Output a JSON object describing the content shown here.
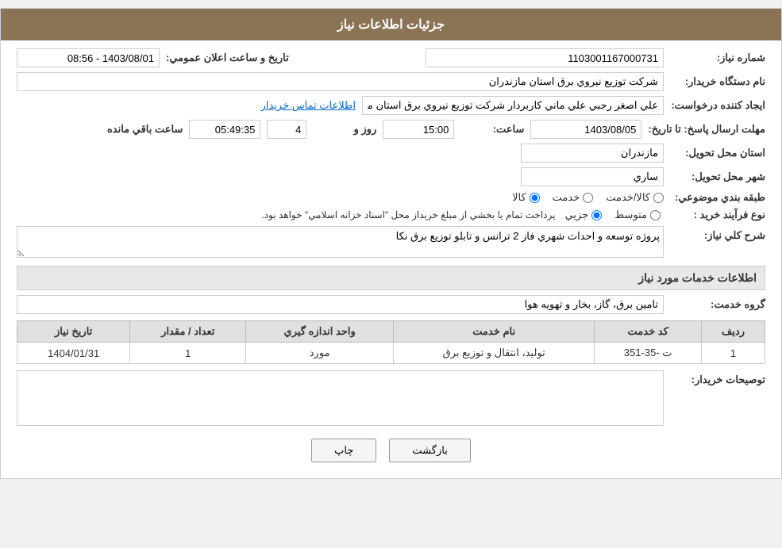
{
  "header": {
    "title": "جزئيات اطلاعات نياز"
  },
  "fields": {
    "request_number_label": "شماره نياز:",
    "request_number_value": "1103001167000731",
    "department_label": "نام دستگاه خريدار:",
    "department_value": "شرکت توزيع نيروي برق استان مازندران",
    "announcement_label": "تاريخ و ساعت اعلان عمومي:",
    "announcement_value": "1403/08/01 - 08:56",
    "creator_label": "ايجاد کننده درخواست:",
    "creator_value": "علي اصغر رجبي علي ماني کاربردار شرکت توزيع نيروي برق استان مازندران",
    "contact_link": "اطلاعات تماس خريدار",
    "response_deadline_label": "مهلت ارسال پاسخ: تا تاريخ:",
    "response_date": "1403/08/05",
    "response_time_label": "ساعت:",
    "response_time": "15:00",
    "response_days_label": "روز و",
    "response_days": "4",
    "response_remaining_label": "ساعت باقي مانده",
    "response_remaining": "05:49:35",
    "province_label": "استان محل تحويل:",
    "province_value": "مازندران",
    "city_label": "شهر محل تحويل:",
    "city_value": "ساري",
    "category_label": "طبقه بندي موضوعي:",
    "category_kala": "کالا",
    "category_khadamat": "خدمت",
    "category_kala_khadamat": "کالا/خدمت",
    "process_label": "نوع فرآيند خريد :",
    "process_jozii": "جزيي",
    "process_motavaset": "متوسط",
    "process_note": "پرداخت تمام يا بخشي از مبلغ خريداز محل \"اسناد خزانه اسلامي\" خواهد بود.",
    "description_label": "شرح کلي نياز:",
    "description_value": "پروژه توسعه و احداث شهري فاز 2 ترانس و تابلو توزيع برق نکا",
    "services_header": "اطلاعات خدمات مورد نياز",
    "service_group_label": "گروه خدمت:",
    "service_group_value": "تامين برق، گاز، بخار و تهويه هوا"
  },
  "table": {
    "headers": [
      "رديف",
      "کد خدمت",
      "نام خدمت",
      "واحد اندازه گيري",
      "تعداد / مقدار",
      "تاريخ نياز"
    ],
    "rows": [
      {
        "row_num": "1",
        "service_code": "ت -35-351",
        "service_name": "توليد، انتقال و توزيع برق",
        "unit": "مورد",
        "quantity": "1",
        "date": "1404/01/31"
      }
    ]
  },
  "buyer_notes_label": "توصيحات خريدار:",
  "buttons": {
    "print": "چاپ",
    "back": "بازگشت"
  }
}
